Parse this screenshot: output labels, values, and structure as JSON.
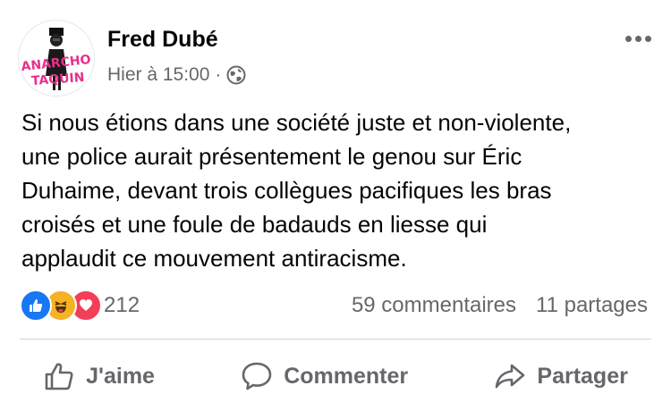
{
  "post": {
    "author": "Fred Dubé",
    "timestamp": "Hier à 15:00",
    "separator": "·",
    "privacy_icon": "globe-icon",
    "avatar_text": [
      "ANARCHO",
      "TAQUIN"
    ],
    "text_lines": [
      "Si nous étions dans une société juste et non-violente,",
      "une police aurait présentement le genou sur Éric",
      "Duhaime, devant trois collègues pacifiques les bras",
      "croisés et une foule de badauds en liesse qui",
      "applaudit ce mouvement antiracisme."
    ]
  },
  "stats": {
    "reaction_icons": [
      "like-reaction-icon",
      "haha-reaction-icon",
      "love-reaction-icon"
    ],
    "reaction_count": "212",
    "comments": "59 commentaires",
    "shares": "11 partages"
  },
  "actions": {
    "like": "J'aime",
    "comment": "Commenter",
    "share": "Partager"
  },
  "colors": {
    "text": "#050505",
    "secondary": "#65676b",
    "like_blue": "#1877f2",
    "haha_yellow": "#f7b125",
    "love_red": "#f33e58",
    "avatar_pink": "#e8308a"
  }
}
